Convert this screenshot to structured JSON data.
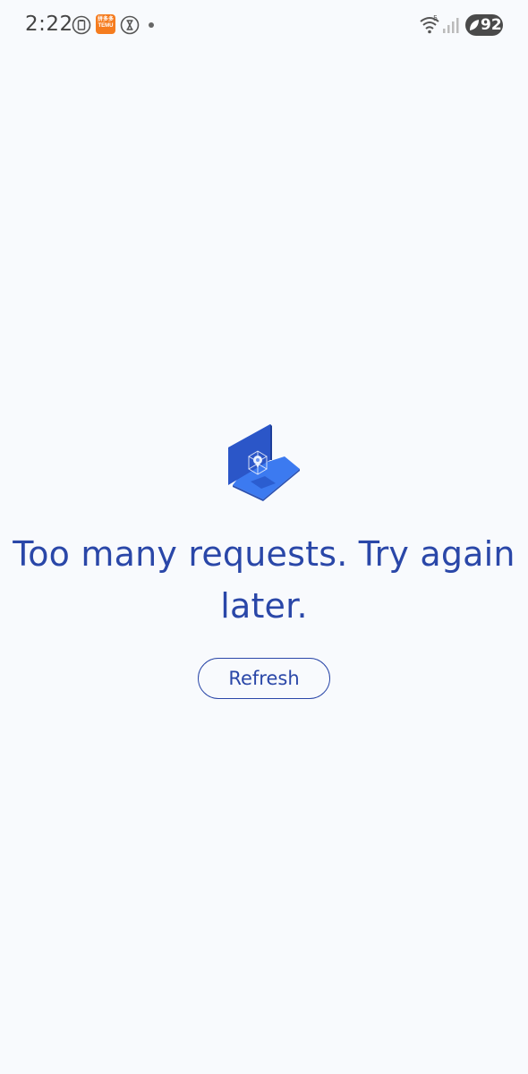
{
  "status_bar": {
    "time": "2:22",
    "temu_line1": "拼多多",
    "temu_line2": "TEMU",
    "wifi_badge": "5",
    "battery_level": "92"
  },
  "main": {
    "message": "Too many requests. Try again later.",
    "refresh_label": "Refresh"
  },
  "colors": {
    "accent": "#2a47a8",
    "background": "#f8fafd",
    "illustration_blue": "#2f6ae0"
  }
}
